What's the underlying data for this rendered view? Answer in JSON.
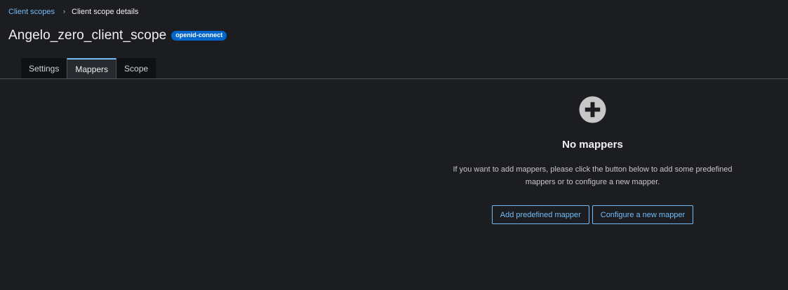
{
  "breadcrumb": {
    "parent": "Client scopes",
    "separator": "›",
    "current": "Client scope details"
  },
  "header": {
    "title": "Angelo_zero_client_scope",
    "badge": "openid-connect"
  },
  "tabs": [
    {
      "label": "Settings",
      "active": false
    },
    {
      "label": "Mappers",
      "active": true
    },
    {
      "label": "Scope",
      "active": false
    }
  ],
  "empty_state": {
    "icon": "plus-circle-icon",
    "title": "No mappers",
    "body": "If you want to add mappers, please click the button below to add some predefined mappers or to configure a new mapper.",
    "primary_action": "Add predefined mapper",
    "secondary_action": "Configure a new mapper"
  },
  "colors": {
    "background": "#1b1d21",
    "link": "#73bcf7",
    "badge": "#0066cc",
    "icon": "#c7c7c7"
  }
}
